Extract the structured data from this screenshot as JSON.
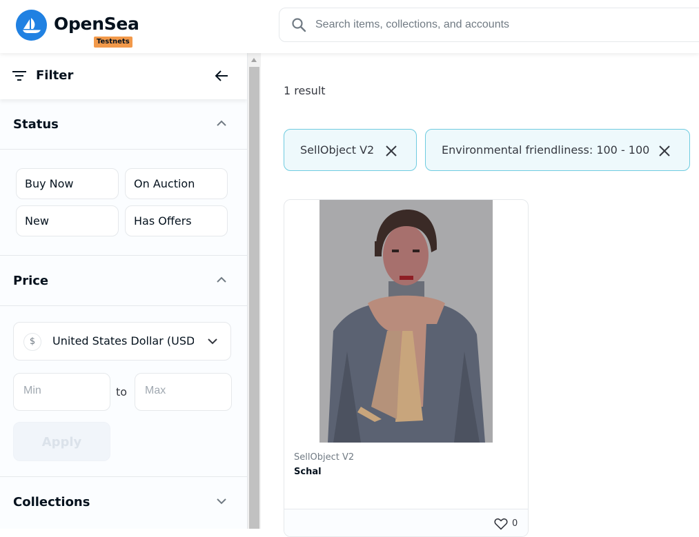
{
  "header": {
    "brand": "OpenSea",
    "badge": "Testnets",
    "search_placeholder": "Search items, collections, and accounts",
    "accent": "#2081e2"
  },
  "sidebar": {
    "filter_title": "Filter",
    "status": {
      "title": "Status",
      "options": [
        "Buy Now",
        "On Auction",
        "New",
        "Has Offers"
      ]
    },
    "price": {
      "title": "Price",
      "currency": "United States Dollar (USD)",
      "min_placeholder": "Min",
      "max_placeholder": "Max",
      "to_label": "to",
      "apply_label": "Apply"
    },
    "collections": {
      "title": "Collections"
    }
  },
  "main": {
    "result_count": "1 result",
    "active_filters": [
      "SellObject V2",
      "Environmental friendliness: 100 - 100"
    ],
    "items": [
      {
        "collection": "SellObject V2",
        "name": "Schal",
        "likes": "0"
      }
    ]
  }
}
